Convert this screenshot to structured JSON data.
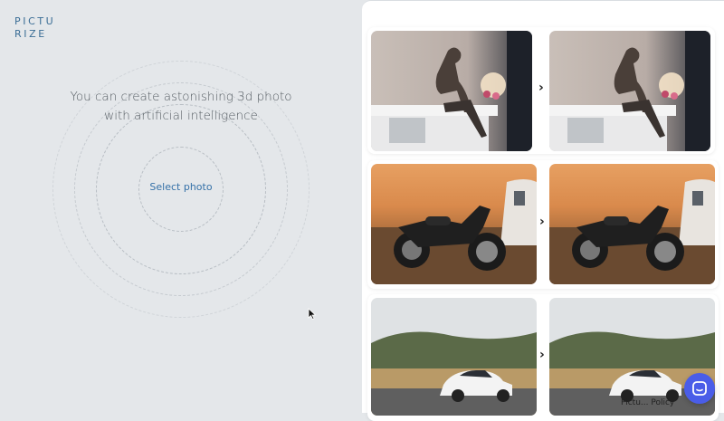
{
  "brand": {
    "logo_line1": "PICTU",
    "logo_line2": "RIZE"
  },
  "hero": {
    "tagline_line1": "You can create astonishing 3d photo",
    "tagline_line2": "with artificial intelligence",
    "select_label": "Select photo"
  },
  "gallery": {
    "arrow": "›",
    "items": [
      {
        "subject": "woman sitting on bathtub"
      },
      {
        "subject": "motorcycle at sunset beside trailer"
      },
      {
        "subject": "white car on mountain road"
      }
    ]
  },
  "footer": {
    "link_text": "Pictu... Policy"
  },
  "colors": {
    "brand_blue": "#3b6e96",
    "chat_button": "#4a5de8"
  }
}
